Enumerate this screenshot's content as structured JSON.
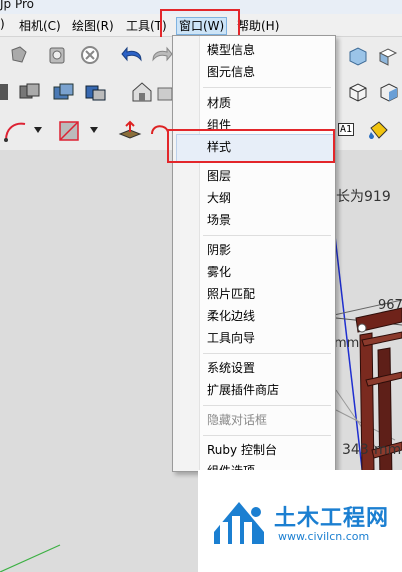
{
  "window": {
    "title_fragment": "Jp Pro"
  },
  "menubar": {
    "items": [
      {
        "label": ")"
      },
      {
        "label": "相机(C)"
      },
      {
        "label": "绘图(R)"
      },
      {
        "label": "工具(T)"
      },
      {
        "label": "窗口(W)"
      },
      {
        "label": "帮助(H)"
      }
    ],
    "active": "窗口(W)"
  },
  "window_menu": {
    "items": [
      {
        "label": "模型信息"
      },
      {
        "label": "图元信息"
      },
      {
        "label": "材质"
      },
      {
        "label": "组件"
      },
      {
        "label": "样式"
      },
      {
        "label": "图层"
      },
      {
        "label": "大纲"
      },
      {
        "label": "场景"
      },
      {
        "label": "阴影"
      },
      {
        "label": "雾化"
      },
      {
        "label": "照片匹配"
      },
      {
        "label": "柔化边线"
      },
      {
        "label": "工具向导"
      },
      {
        "label": "系统设置"
      },
      {
        "label": "扩展插件商店"
      },
      {
        "label": "隐藏对话框",
        "disabled": true
      },
      {
        "label": "Ruby 控制台"
      },
      {
        "label": "组件选项"
      }
    ],
    "highlighted": "样式"
  },
  "toolbar_text": {
    "a1_label": "A1"
  },
  "viewport": {
    "dim_text_1": "长为919",
    "dim_text_2": "967",
    "dim_text_3": "mm",
    "dim_text_4": "343",
    "dim_text_5": "mm"
  },
  "watermark": {
    "brand": "土木工程网",
    "url": "www.civilcn.com"
  },
  "colors": {
    "highlight_box": "#e3262a",
    "axis_blue": "#1f2fd0",
    "wood": "#7a2a1f",
    "watermark_blue": "#1b7fd1"
  }
}
